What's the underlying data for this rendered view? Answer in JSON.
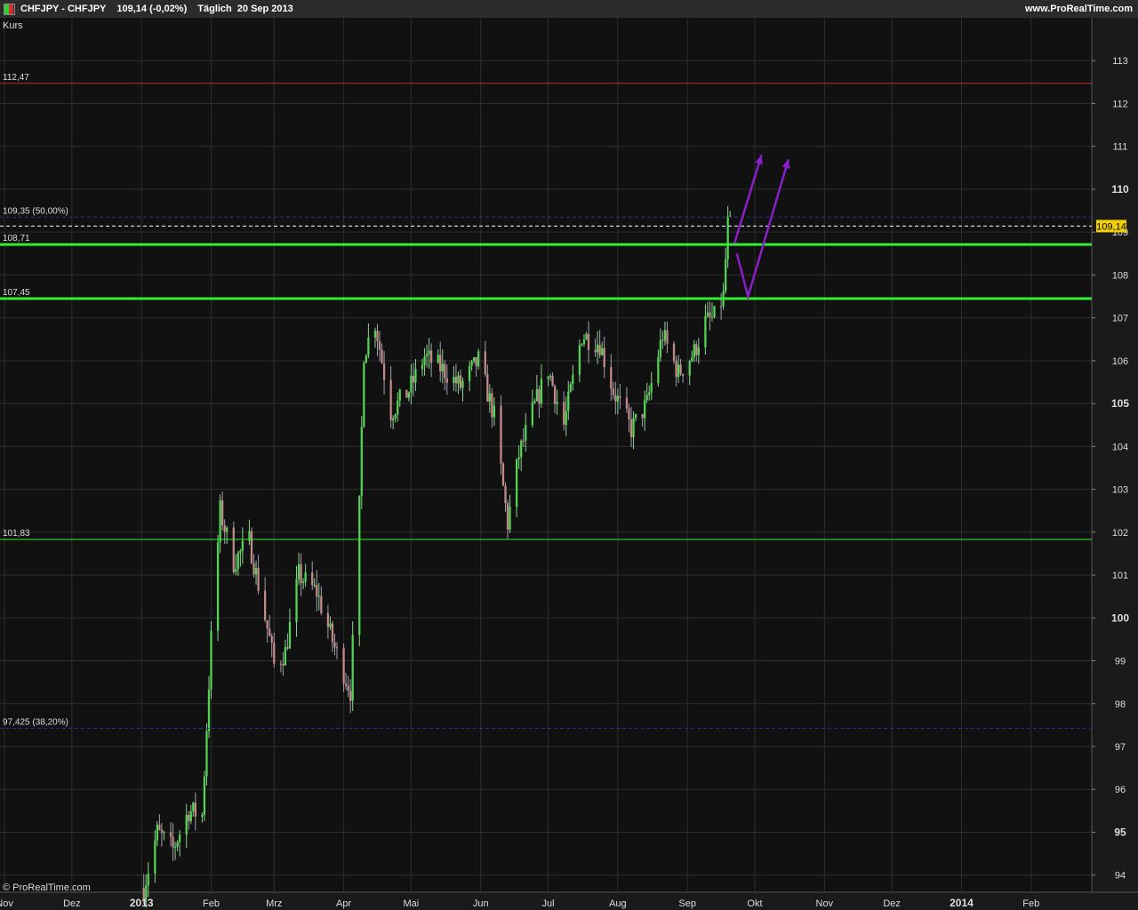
{
  "header": {
    "symbol": "CHFJPY - CHFJPY",
    "quote": "109,14 (-0,02%)",
    "interval": "Täglich",
    "date": "20 Sep 2013",
    "site": "www.ProRealTime.com"
  },
  "panel": {
    "label": "Kurs",
    "copyright": "© ProRealTime.com"
  },
  "colors": {
    "background": "#111111",
    "grid": "#2e2e2e",
    "up": "#54d454",
    "down": "#c48a8a",
    "red_line": "#cc2222",
    "green_line": "#33ee33",
    "fib_line": "#2233aa",
    "arrow": "#8a1fc8",
    "price_box": "#f5d000"
  },
  "chart_data": {
    "type": "candlestick",
    "title": "CHFJPY - CHFJPY",
    "ylim": [
      93.6,
      114.0
    ],
    "y_ticks": [
      94,
      95,
      96,
      97,
      98,
      99,
      100,
      101,
      102,
      103,
      104,
      105,
      106,
      107,
      108,
      109,
      110,
      111,
      112,
      113
    ],
    "y_bold_ticks": [
      95,
      100,
      105,
      110
    ],
    "x_range": [
      "2012-10-30",
      "2014-02-28"
    ],
    "x_labels": [
      {
        "date": "2012-11-01",
        "label": "Nov"
      },
      {
        "date": "2012-12-01",
        "label": "Dez"
      },
      {
        "date": "2013-01-01",
        "label": "2013"
      },
      {
        "date": "2013-02-01",
        "label": "Feb"
      },
      {
        "date": "2013-03-01",
        "label": "Mrz"
      },
      {
        "date": "2013-04-01",
        "label": "Apr"
      },
      {
        "date": "2013-05-01",
        "label": "Mai"
      },
      {
        "date": "2013-06-01",
        "label": "Jun"
      },
      {
        "date": "2013-07-01",
        "label": "Jul"
      },
      {
        "date": "2013-08-01",
        "label": "Aug"
      },
      {
        "date": "2013-09-01",
        "label": "Sep"
      },
      {
        "date": "2013-10-01",
        "label": "Okt"
      },
      {
        "date": "2013-11-01",
        "label": "Nov"
      },
      {
        "date": "2013-12-01",
        "label": "Dez"
      },
      {
        "date": "2014-01-01",
        "label": "2014"
      },
      {
        "date": "2014-02-01",
        "label": "Feb"
      }
    ],
    "price_path": {
      "start": "2013-01-02",
      "end": "2013-09-20",
      "trading_days_per_week": 5,
      "anchors": [
        [
          "2013-01-02",
          93.7
        ],
        [
          "2013-01-08",
          95.0
        ],
        [
          "2013-01-15",
          94.6
        ],
        [
          "2013-01-22",
          95.5
        ],
        [
          "2013-01-28",
          95.4
        ],
        [
          "2013-02-01",
          99.5
        ],
        [
          "2013-02-05",
          102.5
        ],
        [
          "2013-02-11",
          101.3
        ],
        [
          "2013-02-18",
          101.8
        ],
        [
          "2013-02-27",
          99.5
        ],
        [
          "2013-03-01",
          98.9
        ],
        [
          "2013-03-06",
          99.2
        ],
        [
          "2013-03-12",
          101.0
        ],
        [
          "2013-03-20",
          100.6
        ],
        [
          "2013-03-28",
          99.3
        ],
        [
          "2013-04-04",
          98.3
        ],
        [
          "2013-04-08",
          102.6
        ],
        [
          "2013-04-10",
          106.2
        ],
        [
          "2013-04-15",
          106.9
        ],
        [
          "2013-04-22",
          104.8
        ],
        [
          "2013-04-30",
          105.3
        ],
        [
          "2013-05-07",
          106.1
        ],
        [
          "2013-05-15",
          105.8
        ],
        [
          "2013-05-23",
          105.4
        ],
        [
          "2013-05-31",
          106.0
        ],
        [
          "2013-06-07",
          104.7
        ],
        [
          "2013-06-13",
          102.2
        ],
        [
          "2013-06-18",
          103.8
        ],
        [
          "2013-06-24",
          104.8
        ],
        [
          "2013-07-01",
          105.8
        ],
        [
          "2013-07-08",
          104.5
        ],
        [
          "2013-07-16",
          106.6
        ],
        [
          "2013-07-24",
          106.4
        ],
        [
          "2013-07-30",
          105.3
        ],
        [
          "2013-08-07",
          104.4
        ],
        [
          "2013-08-14",
          105.0
        ],
        [
          "2013-08-21",
          106.6
        ],
        [
          "2013-08-28",
          105.7
        ],
        [
          "2013-09-04",
          106.2
        ],
        [
          "2013-09-09",
          106.9
        ],
        [
          "2013-09-13",
          107.0
        ],
        [
          "2013-09-17",
          107.5
        ],
        [
          "2013-09-19",
          109.2
        ],
        [
          "2013-09-20",
          109.14
        ]
      ]
    },
    "last_price": 109.14,
    "last_price_label": "109,14",
    "horizontal_lines": [
      {
        "value": 112.47,
        "label": "112,47",
        "color": "#cc2222",
        "style": "solid"
      },
      {
        "value": 109.35,
        "label": "109,35 (50,00%)",
        "color": "#2233aa",
        "style": "dashed"
      },
      {
        "value": 109.14,
        "label": "",
        "color": "#ffffff",
        "style": "dashed"
      },
      {
        "value": 108.71,
        "label": "108,71",
        "color": "#33ee33",
        "style": "thick"
      },
      {
        "value": 107.45,
        "label": "107,45",
        "color": "#33ee33",
        "style": "thick"
      },
      {
        "value": 101.83,
        "label": "101,83",
        "color": "#33ee33",
        "style": "thin"
      },
      {
        "value": 97.425,
        "label": "97,425 (38,20%)",
        "color": "#2233aa",
        "style": "dashed"
      }
    ],
    "arrows": [
      {
        "points": [
          [
            "2013-09-22",
            108.75
          ],
          [
            "2013-10-04",
            110.8
          ]
        ]
      },
      {
        "points": [
          [
            "2013-09-23",
            108.5
          ],
          [
            "2013-09-28",
            107.5
          ],
          [
            "2013-10-16",
            110.7
          ]
        ]
      }
    ]
  }
}
